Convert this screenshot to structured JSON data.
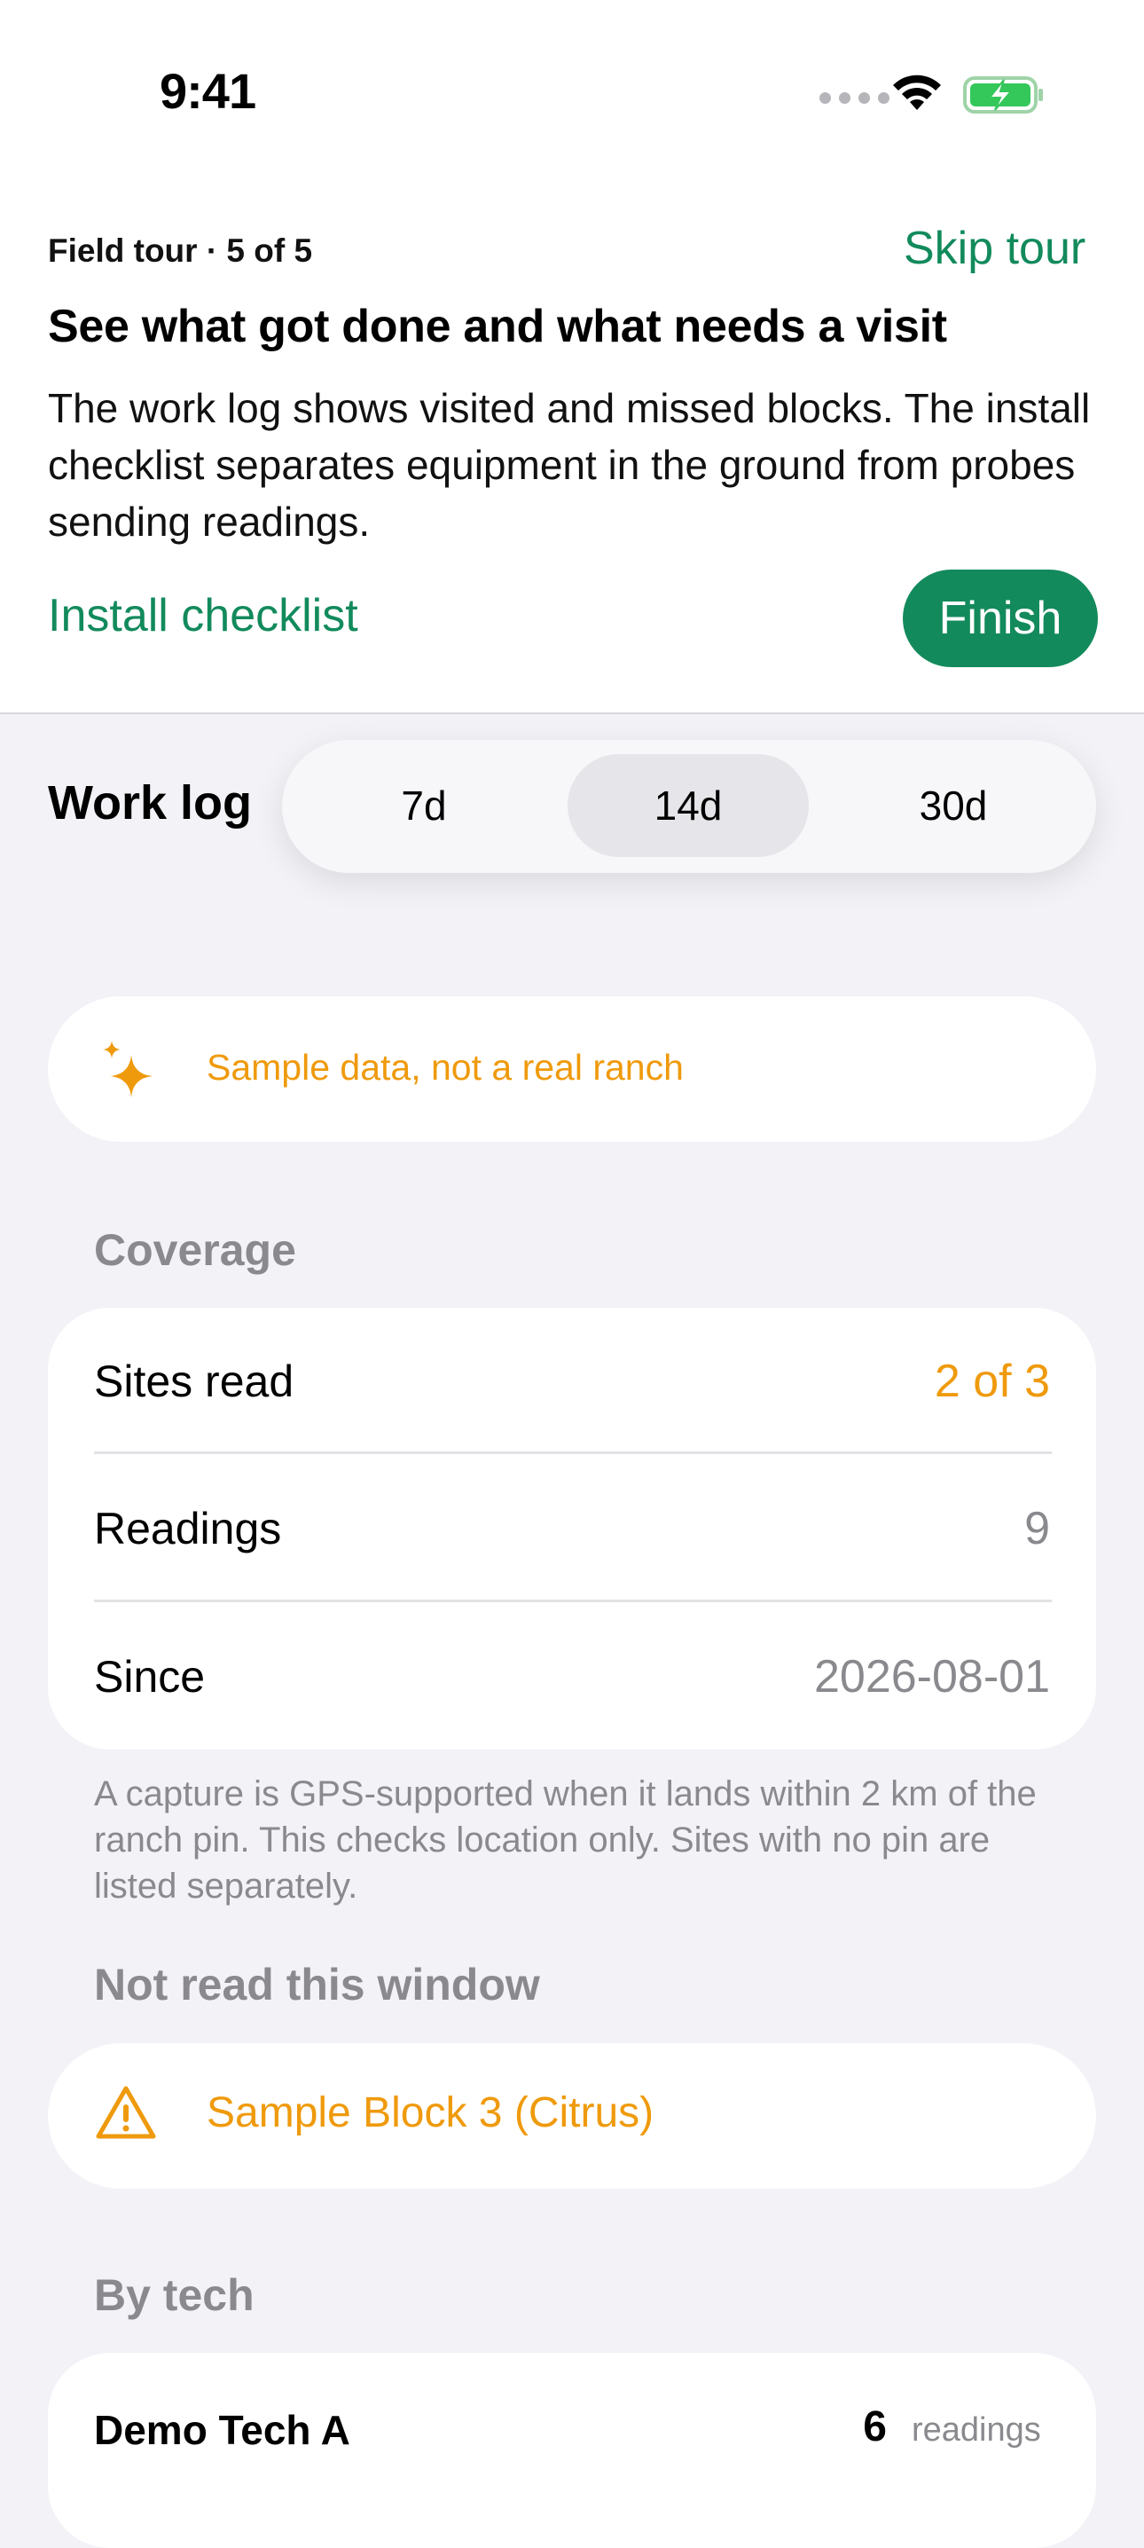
{
  "status_bar": {
    "time": "9:41"
  },
  "tour": {
    "step": "Field tour · 5 of 5",
    "skip_label": "Skip tour",
    "title": "See what got done and what needs a visit",
    "body": "The work log shows visited and missed blocks. The install checklist separates equipment in the ground from probes sending readings.",
    "link_label": "Install checklist",
    "finish_label": "Finish"
  },
  "work_log": {
    "title": "Work log",
    "ranges": [
      "7d",
      "14d",
      "30d"
    ],
    "selected_range": "14d"
  },
  "banner": {
    "icon": "sparkles-icon",
    "text": "Sample data, not a real ranch"
  },
  "coverage": {
    "header": "Coverage",
    "rows": [
      {
        "label": "Sites read",
        "value": "2 of 3"
      },
      {
        "label": "Readings",
        "value": "9"
      },
      {
        "label": "Since",
        "value": "2026-08-01"
      }
    ],
    "footnote": "A capture is GPS-supported when it lands within 2 km of the ranch pin. This checks location only. Sites with no pin are listed separately."
  },
  "not_read": {
    "header": "Not read this window",
    "items": [
      {
        "icon": "warning-triangle-icon",
        "label": "Sample Block 3 (Citrus)"
      }
    ]
  },
  "by_tech": {
    "header": "By tech",
    "items": [
      {
        "name": "Demo Tech A",
        "count": "6",
        "unit": "readings"
      }
    ]
  },
  "colors": {
    "accent_green": "#138a5c",
    "warning_orange": "#ef9a0c",
    "secondary_gray": "#8a8a8e",
    "background": "#f2f2f7"
  }
}
